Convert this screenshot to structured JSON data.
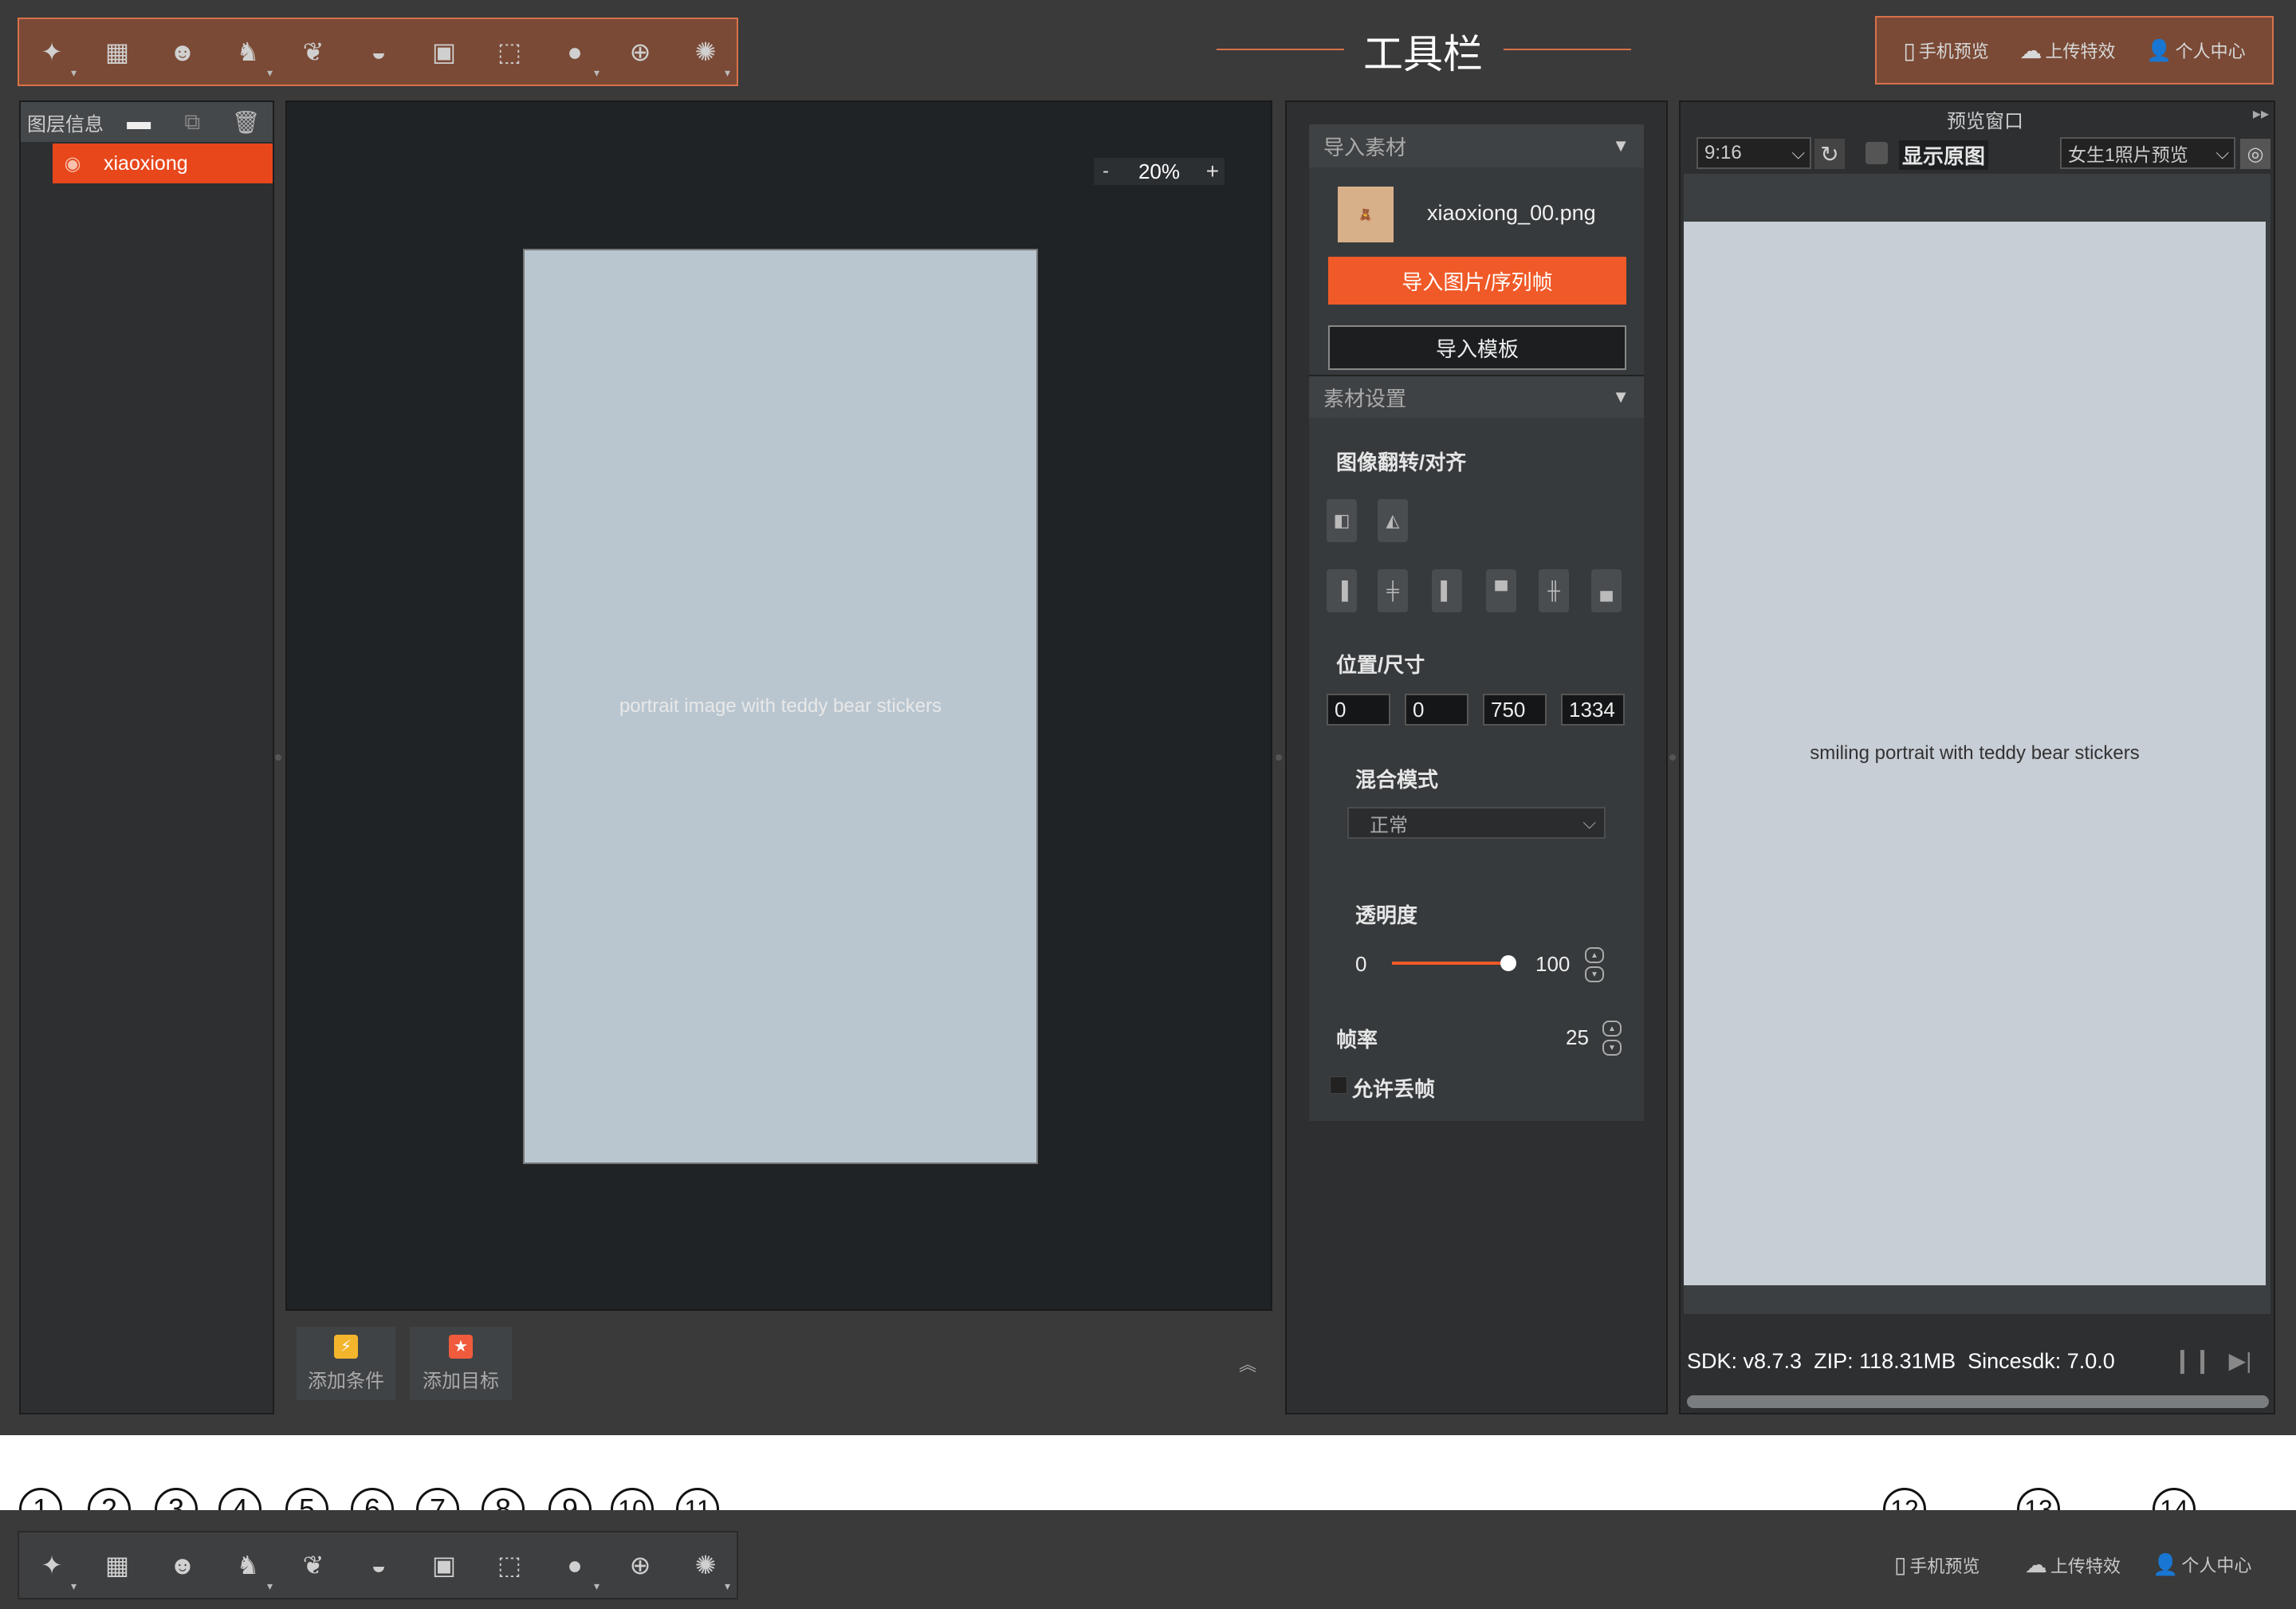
{
  "toolbar": {
    "title": "工具栏",
    "icons": [
      "wand-icon",
      "grid-icon",
      "face-icon",
      "hair-icon",
      "makeup-icon",
      "contour-icon",
      "image-icon",
      "transform-icon",
      "sticker-icon",
      "mask-icon",
      "effect-icon"
    ],
    "right": [
      {
        "label": "手机预览",
        "icon": "phone-icon"
      },
      {
        "label": "上传特效",
        "icon": "cloud-upload-icon"
      },
      {
        "label": "个人中心",
        "icon": "user-icon"
      }
    ]
  },
  "layers": {
    "title": "图层信息",
    "items": [
      {
        "name": "xiaoxiong"
      }
    ]
  },
  "canvas": {
    "zoom": "20%",
    "zoom_minus": "-",
    "zoom_plus": "+",
    "image_alt": "portrait image with teddy bear stickers",
    "add_condition": "添加条件",
    "add_target": "添加目标"
  },
  "asset": {
    "import_section": "导入素材",
    "file_name": "xiaoxiong_00.png",
    "import_button": "导入图片/序列帧",
    "import_template": "导入模板",
    "settings_section": "素材设置",
    "flip_align_label": "图像翻转/对齐",
    "pos_size_label": "位置/尺寸",
    "pos_size": [
      "0",
      "0",
      "750",
      "1334"
    ],
    "blend_label": "混合模式",
    "blend_value": "正常",
    "opacity_label": "透明度",
    "opacity_min": "0",
    "opacity_value": "100",
    "opacity_fraction": 1.0,
    "fps_label": "帧率",
    "fps_value": "25",
    "drop_frame_label": "允许丢帧"
  },
  "preview": {
    "title": "预览窗口",
    "ratio": "9:16",
    "show_original": "显示原图",
    "model": "女生1照片预览",
    "image_alt": "smiling portrait with teddy bear stickers",
    "status": "SDK: v8.7.3  ZIP: 118.31MB  Sincesdk: 7.0.0"
  },
  "callouts": [
    "1",
    "2",
    "3",
    "4",
    "5",
    "6",
    "7",
    "8",
    "9",
    "10",
    "11",
    "12",
    "13",
    "14"
  ],
  "colors": {
    "accent": "#f05a28",
    "highlight_border": "#d9714a",
    "layer_selected": "#e8471c"
  }
}
